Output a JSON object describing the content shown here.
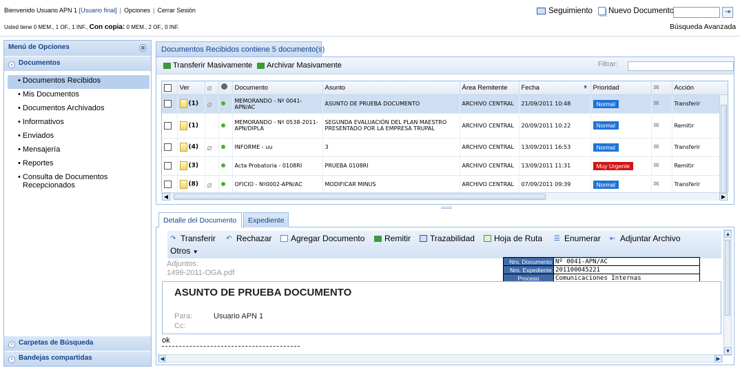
{
  "header": {
    "welcome_prefix": "Bienvenido Usuario APN 1",
    "user_role": "[Usuario final]",
    "options": "Opciones",
    "logout": "Cerrar Sesión",
    "counts_prefix": "Usted tiene 0 MEM., 1 OF., 1 INF.,",
    "counts_copy_label": "Con copia:",
    "counts_copy_values": "0 MEM., 2 OF., 0 INF.",
    "seguimiento": "Seguimiento",
    "nuevo_documento": "Nuevo Documento",
    "search_value": "",
    "busqueda_avanzada": "Búsqueda Avanzada"
  },
  "sidebar": {
    "title": "Menú de Opciones",
    "section": "Documentos",
    "items": [
      {
        "label": "• Documentos Recibidos"
      },
      {
        "label": "• Mis Documentos"
      },
      {
        "label": "• Documentos Archivados"
      },
      {
        "label": "• Informativos"
      },
      {
        "label": "• Enviados"
      },
      {
        "label": "• Mensajería"
      },
      {
        "label": "• Reportes"
      },
      {
        "label": "• Consulta de Documentos Recepcionados"
      }
    ],
    "bottom_sections": [
      "Carpetas de Búsqueda",
      "Bandejas compartidas"
    ]
  },
  "main": {
    "tab_label": "Documentos Recibidos contiene 5 documento(s)",
    "toolbar": {
      "transferir": "Transferir Masivamente",
      "archivar": "Archivar Masivamente",
      "filtrar": "Filtrar:",
      "filtrar_value": ""
    },
    "columns": [
      "Ver",
      "Documento",
      "Asunto",
      "Área Remitente",
      "Fecha",
      "Prioridad",
      "Acción"
    ],
    "rows": [
      {
        "count": "(1)",
        "documento": "MEMORANDO - Nº 0041-APN/AC",
        "asunto": "ASUNTO DE PRUEBA DOCUMENTO",
        "area": "ARCHIVO CENTRAL",
        "fecha": "21/09/2011 10:48",
        "prioridad": "Normal",
        "accion": "Transferir"
      },
      {
        "count": "(1)",
        "documento": "MEMORANDO - Nº 0538-2011-APN/DIPLA",
        "asunto": "SEGUNDA EVALUACIÓN DEL PLAN MAESTRO PRESENTADO POR LA EMPRESA TRUPAL",
        "area": "ARCHIVO CENTRAL",
        "fecha": "20/09/2011 10:22",
        "prioridad": "Normal",
        "accion": "Remitir"
      },
      {
        "count": "(4)",
        "documento": "INFORME - uu",
        "asunto": "3",
        "area": "ARCHIVO CENTRAL",
        "fecha": "13/09/2011 16:53",
        "prioridad": "Normal",
        "accion": "Transferir"
      },
      {
        "count": "(3)",
        "documento": "Acta Probatoria - 0108RI",
        "asunto": "PRUEBA 0108RI",
        "area": "ARCHIVO CENTRAL",
        "fecha": "13/09/2011 11:31",
        "prioridad": "Muy Urgente",
        "accion": "Remitir"
      },
      {
        "count": "(8)",
        "documento": "OFICIO - Nº0002-APN/AC",
        "asunto": "MODIFICAR MINUS",
        "area": "ARCHIVO CENTRAL",
        "fecha": "07/09/2011 09:39",
        "prioridad": "Normal",
        "accion": "Transferir"
      }
    ]
  },
  "detail": {
    "tabs": [
      "Detalle del Documento",
      "Expediente"
    ],
    "toolbar": [
      "Transferir",
      "Rechazar",
      "Agregar Documento",
      "Remitir",
      "Trazabilidad",
      "Hoja de Ruta",
      "Enumerar",
      "Adjuntar Archivo"
    ],
    "otros": "Otros",
    "adjuntos_label": "Adjuntos:",
    "adjunto_file": "1499-2011-OGA.pdf",
    "meta": [
      {
        "key": "Nro. Documento",
        "value": "Nº 0041-APN/AC"
      },
      {
        "key": "Nro. Expediente",
        "value": "201100045221"
      },
      {
        "key": "Proceso",
        "value": "Comunicaciones Internas"
      }
    ],
    "doc_title": "ASUNTO DE PRUEBA DOCUMENTO",
    "para_label": "Para:",
    "para_value": "Usuario APN 1",
    "cc_label": "Cc:",
    "body": "ok"
  },
  "colors": {
    "accent": "#15428b",
    "normal_badge": "#1f73d7",
    "urgent_badge": "#d21414"
  }
}
